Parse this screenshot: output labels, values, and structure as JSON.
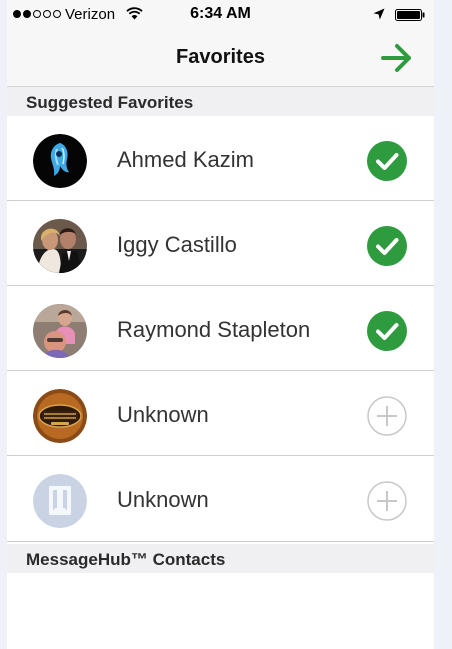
{
  "status_bar": {
    "carrier": "Verizon",
    "time": "6:34 AM",
    "signal_bars_filled": 2,
    "signal_bars_total": 5
  },
  "nav": {
    "title": "Favorites",
    "next_icon": "arrow-right-icon"
  },
  "sections": {
    "suggested": "Suggested Favorites",
    "contacts": "MessageHub™ Contacts"
  },
  "favorites": [
    {
      "name": "Ahmed Kazim",
      "selected": true,
      "avatar": "ahmed-avatar"
    },
    {
      "name": "Iggy Castillo",
      "selected": true,
      "avatar": "iggy-avatar"
    },
    {
      "name": "Raymond Stapleton",
      "selected": true,
      "avatar": "raymond-avatar"
    },
    {
      "name": "Unknown",
      "selected": false,
      "avatar": "steampunk-avatar"
    },
    {
      "name": "Unknown",
      "selected": false,
      "avatar": "placeholder-avatar"
    }
  ],
  "colors": {
    "accent_green": "#2e9b3f",
    "unselected_gray": "#c8c8c8"
  }
}
